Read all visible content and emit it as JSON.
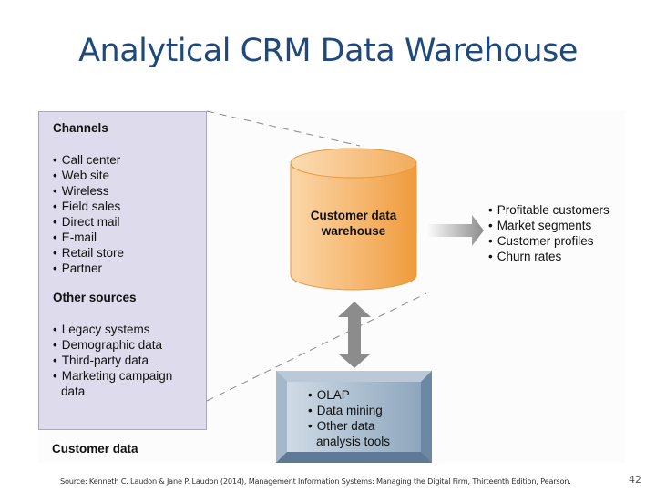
{
  "title": "Analytical CRM Data Warehouse",
  "diagram": {
    "channels": {
      "heading": "Channels",
      "items": [
        "Call center",
        "Web site",
        "Wireless",
        "Field sales",
        "Direct mail",
        "E-mail",
        "Retail store",
        "Partner"
      ]
    },
    "other_sources": {
      "heading": "Other sources",
      "items": [
        "Legacy systems",
        "Demographic data",
        "Third-party data"
      ],
      "last_item_line1": "Marketing campaign",
      "last_item_line2": "data"
    },
    "customer_data_label": "Customer data",
    "warehouse": {
      "line1": "Customer data",
      "line2": "warehouse"
    },
    "outputs": [
      "Profitable customers",
      "Market segments",
      "Customer profiles",
      "Churn rates"
    ],
    "tools": {
      "items": [
        "OLAP",
        "Data mining"
      ],
      "last_item_line1": "Other data",
      "last_item_line2": "analysis tools"
    },
    "colors": {
      "title": "#1f497d",
      "source_box": "#dddbec",
      "cylinder_light": "#f9cf9a",
      "cylinder_dark": "#ef9b3c",
      "tool_box": "#8ea6bd",
      "arrow": "#8c8c8c"
    }
  },
  "footer": {
    "source": "Source: Kenneth C. Laudon & Jane P. Laudon (2014), Management Information Systems: Managing the Digital Firm, Thirteenth Edition, Pearson.",
    "page_number": "42"
  }
}
